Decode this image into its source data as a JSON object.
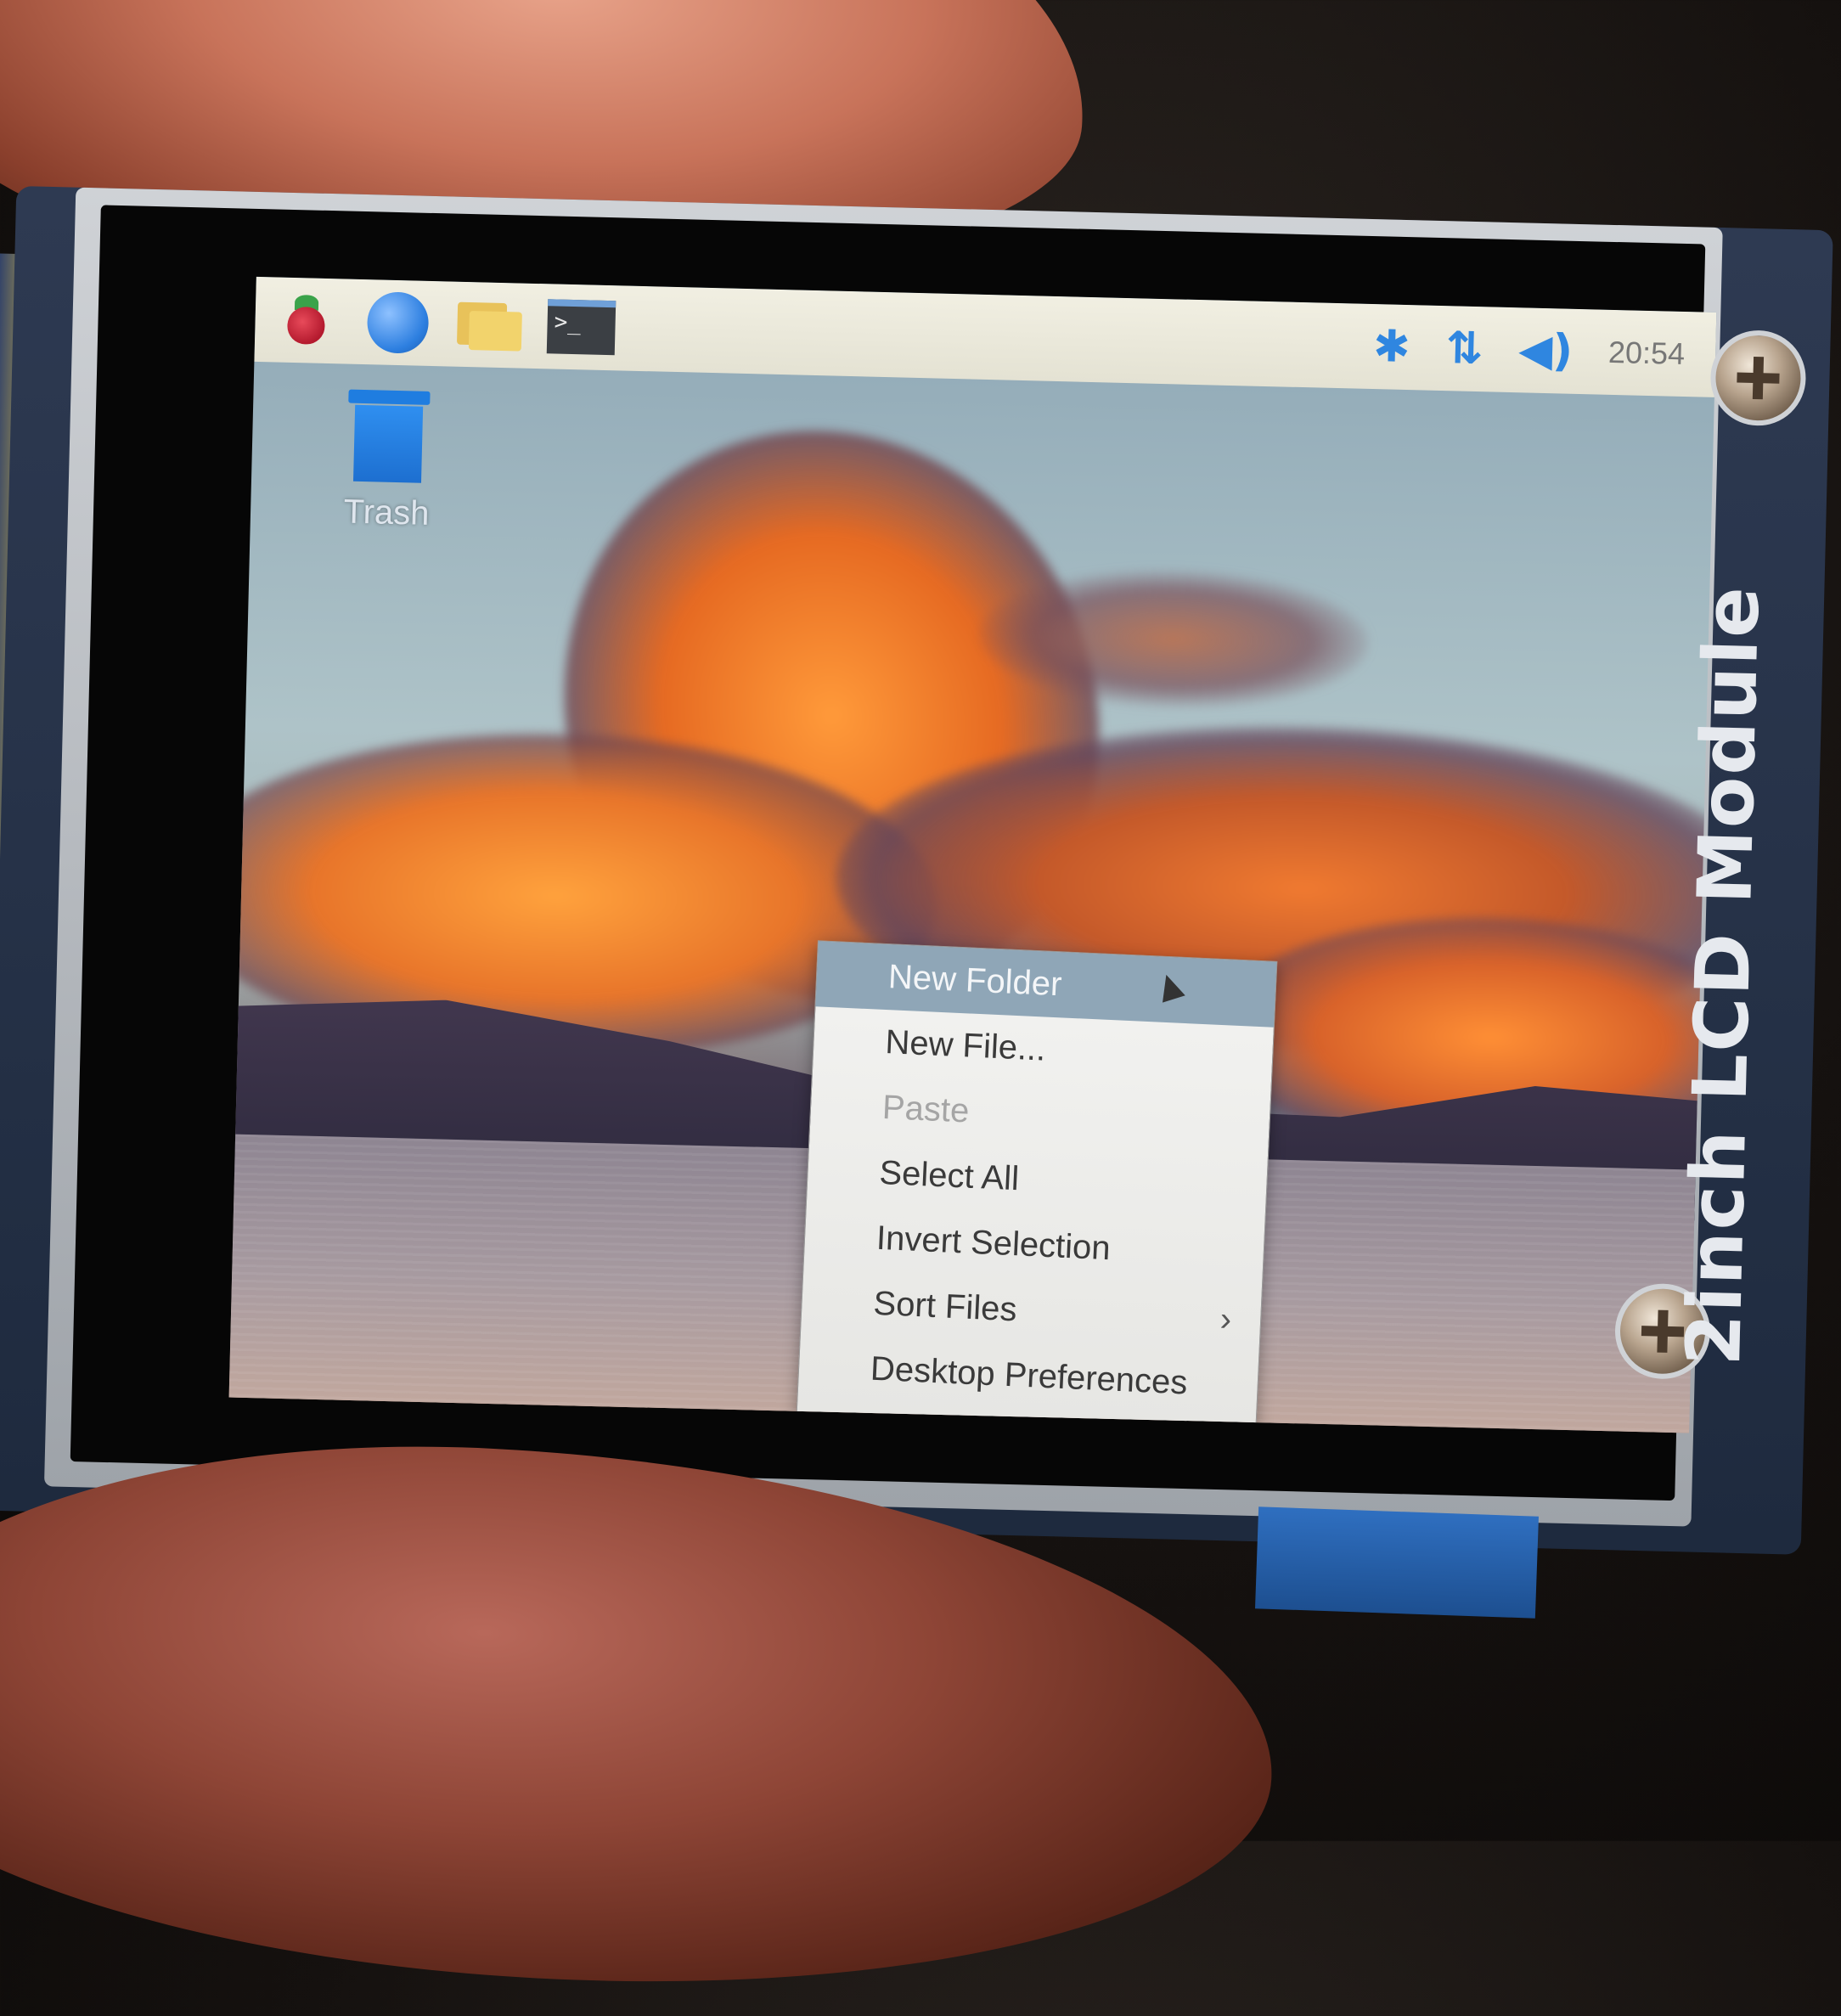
{
  "scene": {
    "device_label": "2inch LCD Module"
  },
  "taskbar": {
    "launchers": [
      {
        "icon": "raspberry-menu-icon"
      },
      {
        "icon": "browser-globe-icon"
      },
      {
        "icon": "file-manager-folder-icon"
      },
      {
        "icon": "terminal-icon",
        "glyph": ">_"
      }
    ],
    "tray": {
      "bluetooth_glyph": "✱",
      "network_glyph": "⇅",
      "volume_glyph": "◀)",
      "clock": "20:54"
    },
    "colors": {
      "tray_accent": "#2f86e0",
      "panel_bg": "#f1efe2"
    }
  },
  "desktop": {
    "icons": [
      {
        "label": "Trash",
        "icon": "trash-icon"
      }
    ]
  },
  "context_menu": {
    "items": [
      {
        "label": "New Folder",
        "state": "highlighted"
      },
      {
        "label": "New File...",
        "state": "normal"
      },
      {
        "label": "Paste",
        "state": "disabled"
      },
      {
        "label": "Select All",
        "state": "normal"
      },
      {
        "label": "Invert Selection",
        "state": "normal"
      },
      {
        "label": "Sort Files",
        "state": "normal",
        "submenu_arrow": "›"
      },
      {
        "label": "Desktop Preferences",
        "state": "normal"
      }
    ],
    "colors": {
      "highlight": "#8fa6b7",
      "background": "#f3f3f1"
    }
  }
}
